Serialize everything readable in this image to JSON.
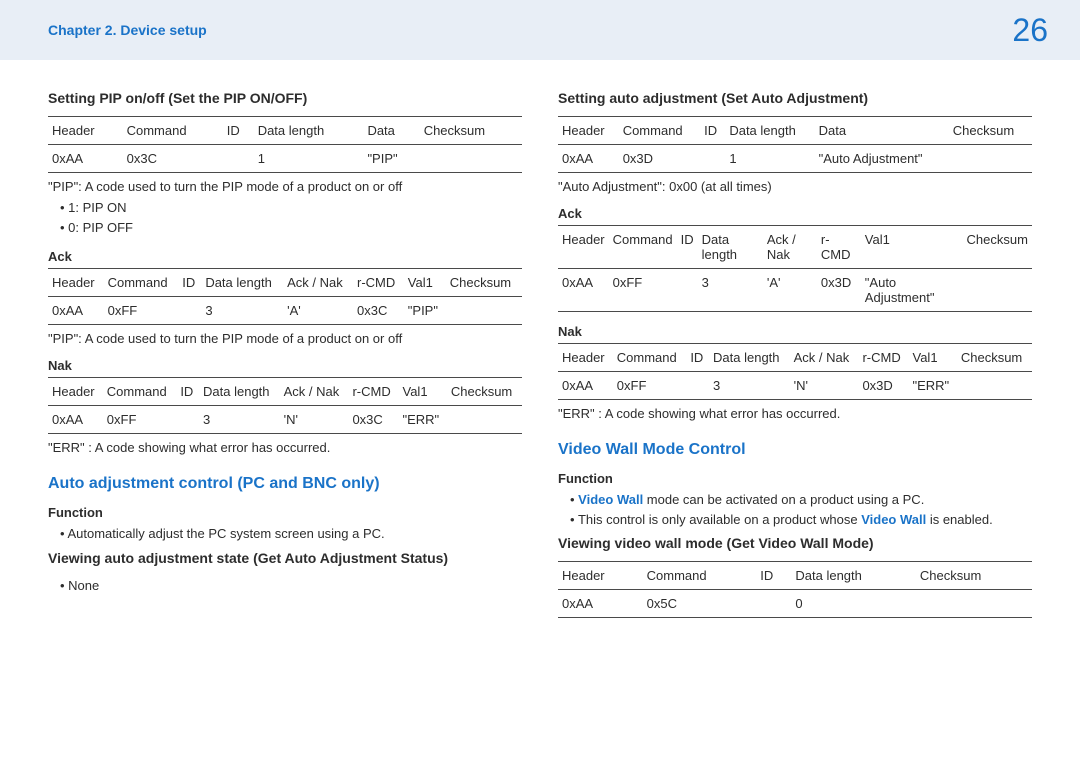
{
  "header": {
    "chapter": "Chapter 2. Device setup",
    "page": "26"
  },
  "left": {
    "s1": {
      "title": "Setting PIP on/off (Set the PIP ON/OFF)",
      "tbl": {
        "h": [
          "Header",
          "Command",
          "ID",
          "Data length",
          "Data",
          "Checksum"
        ],
        "r": [
          "0xAA",
          "0x3C",
          "",
          "1",
          "\"PIP\"",
          ""
        ]
      },
      "note1": "\"PIP\": A code used to turn the PIP mode of a product on or off",
      "bul1": "1: PIP ON",
      "bul2": "0: PIP OFF"
    },
    "ack": {
      "title": "Ack",
      "tbl": {
        "h": [
          "Header",
          "Command",
          "ID",
          "Data length",
          "Ack / Nak",
          "r-CMD",
          "Val1",
          "Checksum"
        ],
        "r": [
          "0xAA",
          "0xFF",
          "",
          "3",
          "'A'",
          "0x3C",
          "\"PIP\"",
          ""
        ]
      },
      "note": "\"PIP\": A code used to turn the PIP mode of a product on or off"
    },
    "nak": {
      "title": "Nak",
      "tbl": {
        "h": [
          "Header",
          "Command",
          "ID",
          "Data length",
          "Ack / Nak",
          "r-CMD",
          "Val1",
          "Checksum"
        ],
        "r": [
          "0xAA",
          "0xFF",
          "",
          "3",
          "'N'",
          "0x3C",
          "\"ERR\"",
          ""
        ]
      },
      "note": "\"ERR\" : A code showing what error has occurred."
    },
    "s2": {
      "title": "Auto adjustment control (PC and BNC only)",
      "funcTitle": "Function",
      "funcBul": "Automatically adjust the PC system screen using a PC.",
      "viewTitle": "Viewing auto adjustment state (Get Auto Adjustment Status)",
      "viewBul": "None"
    }
  },
  "right": {
    "s1": {
      "title": "Setting auto adjustment (Set Auto Adjustment)",
      "tbl": {
        "h": [
          "Header",
          "Command",
          "ID",
          "Data length",
          "Data",
          "Checksum"
        ],
        "r": [
          "0xAA",
          "0x3D",
          "",
          "1",
          "\"Auto Adjustment\"",
          ""
        ]
      },
      "note1": "\"Auto Adjustment\": 0x00 (at all times)"
    },
    "ack": {
      "title": "Ack",
      "tbl": {
        "h": [
          "Header",
          "Command",
          "ID",
          "Data length",
          "Ack / Nak",
          "r-CMD",
          "Val1",
          "Checksum"
        ],
        "r": [
          "0xAA",
          "0xFF",
          "",
          "3",
          "'A'",
          "0x3D",
          "\"Auto Adjustment\"",
          ""
        ]
      }
    },
    "nak": {
      "title": "Nak",
      "tbl": {
        "h": [
          "Header",
          "Command",
          "ID",
          "Data length",
          "Ack / Nak",
          "r-CMD",
          "Val1",
          "Checksum"
        ],
        "r": [
          "0xAA",
          "0xFF",
          "",
          "3",
          "'N'",
          "0x3D",
          "\"ERR\"",
          ""
        ]
      },
      "note": "\"ERR\" : A code showing what error has occurred."
    },
    "s2": {
      "title": "Video Wall Mode Control",
      "funcTitle": "Function",
      "funcBul1_pre": "Video Wall",
      "funcBul1_post": " mode can be activated on a product using a PC.",
      "funcBul2_pre": "This control is only available on a product whose ",
      "funcBul2_mid": "Video Wall",
      "funcBul2_post": " is enabled.",
      "viewTitle": "Viewing video wall mode (Get Video Wall Mode)",
      "tbl": {
        "h": [
          "Header",
          "Command",
          "ID",
          "Data length",
          "Checksum"
        ],
        "r": [
          "0xAA",
          "0x5C",
          "",
          "0",
          ""
        ]
      }
    }
  }
}
